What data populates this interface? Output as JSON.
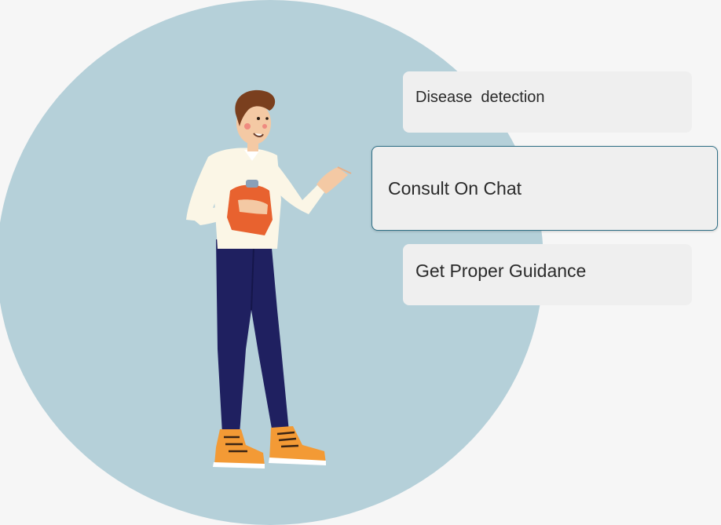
{
  "options": [
    {
      "label": "Disease  detection",
      "selected": false
    },
    {
      "label": "Consult On Chat",
      "selected": true
    },
    {
      "label": "Get Proper Guidance",
      "selected": false
    }
  ],
  "colors": {
    "page_background": "#f6f6f6",
    "circle": "#b5d0d9",
    "card_background": "#efefef",
    "selected_border": "#2f6f86",
    "shirt": "#fbf6e6",
    "pants": "#1f2060",
    "clipboard": "#e8622f",
    "shoes": "#f39a35",
    "hair": "#7a3f1e"
  },
  "illustration": {
    "icon": "man-holding-clipboard-illustration"
  }
}
